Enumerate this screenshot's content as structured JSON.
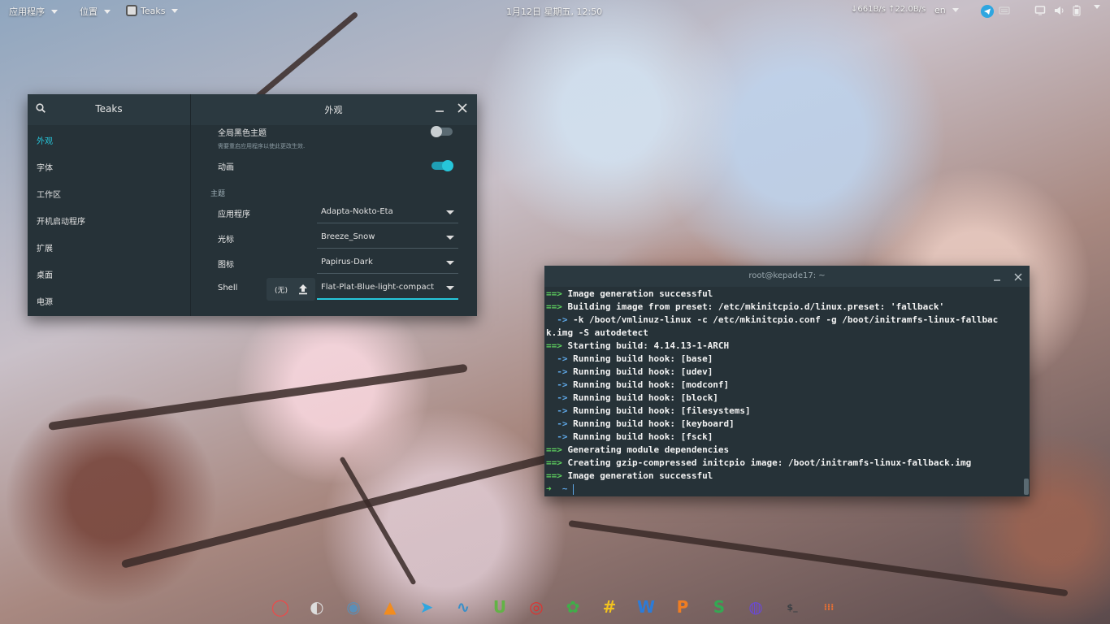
{
  "topbar": {
    "apps_menu": "应用程序",
    "places_menu": "位置",
    "active_app": "Teaks",
    "clock": "1月12日 星期五, 12:50",
    "net_speed": "↓661B/s ↑22.0B/s",
    "lang": "en"
  },
  "tweaks": {
    "title": "Teaks",
    "page_title": "外观",
    "sidebar": [
      {
        "label": "外观",
        "active": true
      },
      {
        "label": "字体"
      },
      {
        "label": "工作区"
      },
      {
        "label": "开机启动程序"
      },
      {
        "label": "扩展"
      },
      {
        "label": "桌面"
      },
      {
        "label": "电源"
      }
    ],
    "dark_theme_label": "全局黑色主题",
    "dark_theme_hint": "需要重启应用程序以使此更改生效.",
    "dark_theme_on": false,
    "animation_label": "动画",
    "animation_on": true,
    "themes_section": "主题",
    "apps_theme_label": "应用程序",
    "apps_theme_value": "Adapta-Nokto-Eta",
    "cursor_label": "光标",
    "cursor_value": "Breeze_Snow",
    "icons_label": "图标",
    "icons_value": "Papirus-Dark",
    "shell_label": "Shell",
    "shell_none": "(无)",
    "shell_value": "Flat-Plat-Blue-light-compact"
  },
  "terminal": {
    "title": "root@kepade17: ~",
    "lines": [
      {
        "p": "==> ",
        "pc": "g",
        "t": "Image generation successful"
      },
      {
        "p": "==> ",
        "pc": "g",
        "t": "Building image from preset: /etc/mkinitcpio.d/linux.preset: 'fallback'"
      },
      {
        "p": "  -> ",
        "pc": "b",
        "t": "-k /boot/vmlinuz-linux -c /etc/mkinitcpio.conf -g /boot/initramfs-linux-fallbac"
      },
      {
        "p": "",
        "pc": "w",
        "t": "k.img -S autodetect"
      },
      {
        "p": "==> ",
        "pc": "g",
        "t": "Starting build: 4.14.13-1-ARCH"
      },
      {
        "p": "  -> ",
        "pc": "b",
        "t": "Running build hook: [base]"
      },
      {
        "p": "  -> ",
        "pc": "b",
        "t": "Running build hook: [udev]"
      },
      {
        "p": "  -> ",
        "pc": "b",
        "t": "Running build hook: [modconf]"
      },
      {
        "p": "  -> ",
        "pc": "b",
        "t": "Running build hook: [block]"
      },
      {
        "p": "  -> ",
        "pc": "b",
        "t": "Running build hook: [filesystems]"
      },
      {
        "p": "  -> ",
        "pc": "b",
        "t": "Running build hook: [keyboard]"
      },
      {
        "p": "  -> ",
        "pc": "b",
        "t": "Running build hook: [fsck]"
      },
      {
        "p": "==> ",
        "pc": "g",
        "t": "Generating module dependencies"
      },
      {
        "p": "==> ",
        "pc": "g",
        "t": "Creating gzip-compressed initcpio image: /boot/initramfs-linux-fallback.img"
      },
      {
        "p": "==> ",
        "pc": "g",
        "t": "Image generation successful"
      }
    ],
    "prompt_arrow": "➜",
    "prompt_dir": "~"
  },
  "dock": [
    {
      "icon": "vivaldi-icon",
      "color": "#e84c4c",
      "glyph": "◯"
    },
    {
      "icon": "disk-cleaner-icon",
      "color": "#dddddd",
      "glyph": "◐"
    },
    {
      "icon": "screenshot-icon",
      "color": "#5a8fb8",
      "glyph": "◉"
    },
    {
      "icon": "vlc-icon",
      "color": "#f28c1e",
      "glyph": "▲"
    },
    {
      "icon": "telegram-icon",
      "color": "#2ea6e0",
      "glyph": "➤"
    },
    {
      "icon": "system-monitor-icon",
      "color": "#3a8fc8",
      "glyph": "∿"
    },
    {
      "icon": "package-manager-icon",
      "color": "#62b346",
      "glyph": "U"
    },
    {
      "icon": "netease-music-icon",
      "color": "#e0312f",
      "glyph": "◎"
    },
    {
      "icon": "app-center-icon",
      "color": "#3fae49",
      "glyph": "✿"
    },
    {
      "icon": "hashtag-app-icon",
      "color": "#f2c31e",
      "glyph": "#"
    },
    {
      "icon": "wps-writer-icon",
      "color": "#2c7bd8",
      "glyph": "W"
    },
    {
      "icon": "wps-presentation-icon",
      "color": "#ef7d22",
      "glyph": "P"
    },
    {
      "icon": "wps-spreadsheet-icon",
      "color": "#34a853",
      "glyph": "S"
    },
    {
      "icon": "firefox-icon",
      "color": "#6a48d8",
      "glyph": "◍"
    },
    {
      "icon": "terminal-icon",
      "color": "#3a3f44",
      "glyph": "$_"
    },
    {
      "icon": "app-grid-icon",
      "color": "#f07030",
      "glyph": "⁞⁞⁞"
    }
  ]
}
